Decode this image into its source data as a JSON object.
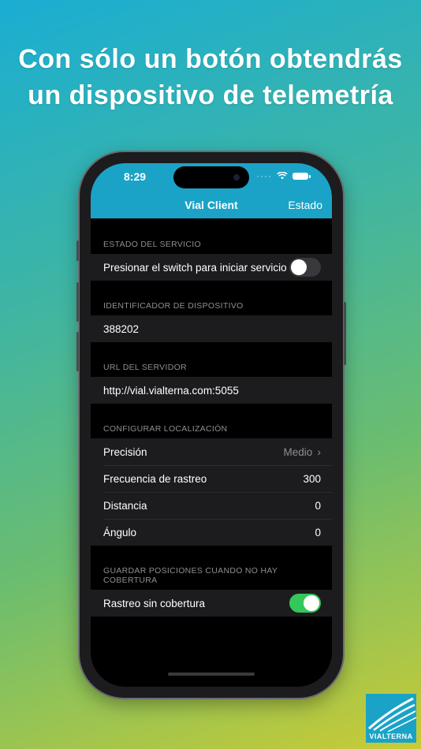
{
  "headline": {
    "line1": "Con sólo un botón obtendrás",
    "line2": "un dispositivo de telemetría"
  },
  "status_bar": {
    "time": "8:29",
    "cellular": "····"
  },
  "nav": {
    "title": "Vial Client",
    "right_label": "Estado"
  },
  "sections": {
    "service": {
      "header": "ESTADO DEL SERVICIO",
      "switch_label": "Presionar el switch para iniciar servicio",
      "switch_on": false
    },
    "device": {
      "header": "IDENTIFICADOR DE DISPOSITIVO",
      "value": "388202"
    },
    "server": {
      "header": "URL DEL SERVIDOR",
      "value": "http://vial.vialterna.com:5055"
    },
    "location": {
      "header": "CONFIGURAR LOCALIZACIÓN",
      "precision_label": "Precisión",
      "precision_value": "Medio",
      "frequency_label": "Frecuencia de rastreo",
      "frequency_value": "300",
      "distance_label": "Distancia",
      "distance_value": "0",
      "angle_label": "Ángulo",
      "angle_value": "0"
    },
    "offline": {
      "header": "GUARDAR POSICIONES CUANDO NO HAY COBERTURA",
      "switch_label": "Rastreo sin cobertura",
      "switch_on": true
    }
  },
  "logo": {
    "text": "VIALTERNA"
  },
  "colors": {
    "accent": "#1aa3c7",
    "switch_on": "#34c759",
    "cell_bg": "#1c1c1e"
  }
}
